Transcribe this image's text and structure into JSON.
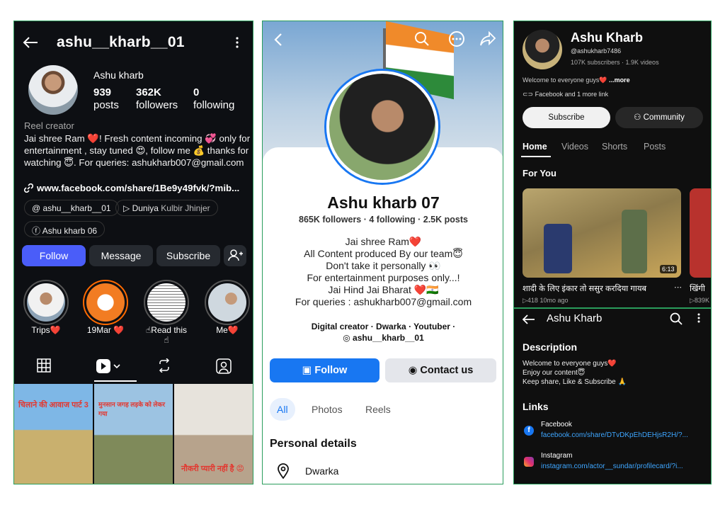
{
  "instagram": {
    "username": "ashu__kharb__01",
    "display_name": "Ashu kharb",
    "stats": [
      {
        "value": "939",
        "label": "posts"
      },
      {
        "value": "362K",
        "label": "followers"
      },
      {
        "value": "0",
        "label": "following"
      }
    ],
    "category": "Reel creator",
    "bio": "Jai shree Ram ❤️! Fresh content incoming 💞 only for entertainment , stay tuned 😍, follow me 💰 thanks for watching 😇. For queries: ashukharb007@gmail.com",
    "link": "www.facebook.com/share/1Be9y49fvk/?mib...",
    "chip_threads": "ashu__kharb__01",
    "chip_music_title": "Duniya",
    "chip_music_artist": "Kulbir Jhinjer",
    "chip_facebook": "Ashu kharb 06",
    "buttons": {
      "follow": "Follow",
      "message": "Message",
      "subscribe": "Subscribe"
    },
    "highlights": [
      "Trips❤️",
      "19Mar ❤️",
      "☝Read this ☝",
      "Me❤️"
    ],
    "thumbs": [
      {
        "caption": "चिलाने की आवाज पार्ट 3"
      },
      {
        "caption": "मुनसान जगह लड़के को लेकर गया"
      },
      {
        "caption": "नौकरी प्यारी नहीं है 😡"
      }
    ],
    "colors": {
      "follow": "#4a5df9",
      "bg": "#0d0f13"
    }
  },
  "facebook": {
    "name": "Ashu kharb 07",
    "counts": "865K followers · 4 following · 2.5K posts",
    "bio_lines": [
      "Jai shree Ram❤️",
      "All Content produced By our team😇",
      "Don't take it personally 👀",
      "For entertainment purposes only...!",
      "Jai Hind Jai Bharat ❤️🇮🇳",
      "For queries : ashukharb007@gmail.com"
    ],
    "meta_line1": "Digital creator · Dwarka · Youtuber ·",
    "meta_line2": "ashu__kharb__01",
    "buttons": {
      "follow": "Follow",
      "contact": "Contact us"
    },
    "tabs": [
      "All",
      "Photos",
      "Reels"
    ],
    "personal_details": "Personal details",
    "location": "Dwarka",
    "colors": {
      "primary": "#1877f2"
    }
  },
  "youtube": {
    "name": "Ashu Kharb",
    "handle": "@ashukharb7486",
    "subs": "107K subscribers · 1.9K videos",
    "welcome": "Welcome to everyone guys❤️",
    "more": "...more",
    "links_line": "Facebook and 1 more link",
    "buttons": {
      "subscribe": "Subscribe",
      "community": "Community"
    },
    "tabs": [
      "Home",
      "Videos",
      "Shorts",
      "Posts"
    ],
    "for_you": "For You",
    "video": {
      "title": "शादी के लिए इंकार तो ससुर करदिया गायब",
      "duration": "6:13",
      "meta": "▷418  10mo ago",
      "title2": "खिंगी",
      "meta2": "▷839K"
    },
    "about_title": "Ashu Kharb",
    "description_heading": "Description",
    "description_lines": [
      "Welcome to everyone guys❤️",
      "Enjoy our content😇",
      "Keep share, Like & Subscribe 🙏"
    ],
    "links_heading": "Links",
    "links": [
      {
        "name": "Facebook",
        "url": "facebook.com/share/DTvDKpEhDEHjsR2H/?..."
      },
      {
        "name": "Instagram",
        "url": "instagram.com/actor__sundar/profilecard/?i..."
      }
    ]
  }
}
